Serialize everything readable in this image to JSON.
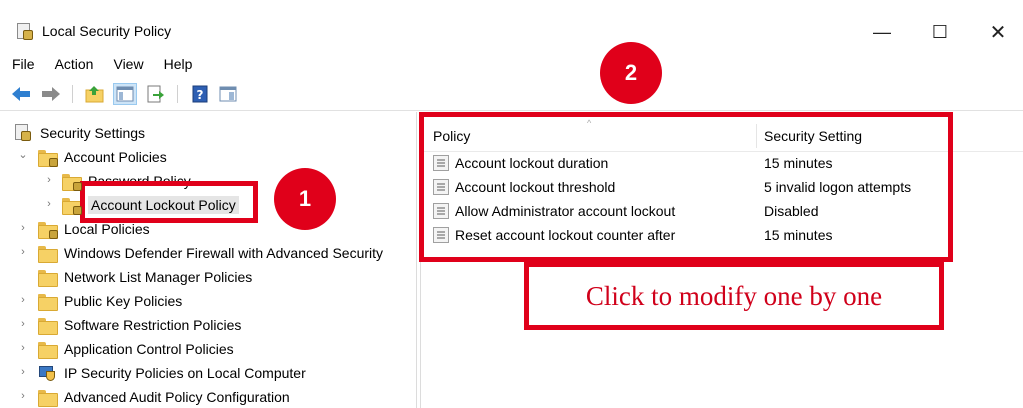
{
  "window": {
    "title": "Local Security Policy",
    "minimize_glyph": "—",
    "maximize_glyph": "☐",
    "close_glyph": "✕"
  },
  "menu": [
    "File",
    "Action",
    "View",
    "Help"
  ],
  "toolbar_icons": [
    "back-arrow-icon",
    "forward-arrow-icon",
    "up-folder-icon",
    "show-hide-tree-icon",
    "export-list-icon",
    "help-icon",
    "console-pane-icon"
  ],
  "tree": {
    "root": "Security Settings",
    "items": [
      {
        "label": "Account Policies",
        "chevron": "⌄"
      },
      {
        "label": "Password Policy",
        "chevron": "›"
      },
      {
        "label": "Account Lockout Policy",
        "chevron": "›"
      },
      {
        "label": "Local Policies",
        "chevron": "›"
      },
      {
        "label": "Windows Defender Firewall with Advanced Security",
        "chevron": "›"
      },
      {
        "label": "Network List Manager Policies",
        "chevron": ""
      },
      {
        "label": "Public Key Policies",
        "chevron": "›"
      },
      {
        "label": "Software Restriction Policies",
        "chevron": "›"
      },
      {
        "label": "Application Control Policies",
        "chevron": "›"
      },
      {
        "label": "IP Security Policies on Local Computer",
        "chevron": "›"
      },
      {
        "label": "Advanced Audit Policy Configuration",
        "chevron": "›"
      }
    ]
  },
  "list": {
    "columns": {
      "policy": "Policy",
      "setting": "Security Setting"
    },
    "sort_caret": "^",
    "rows": [
      {
        "policy": "Account lockout duration",
        "setting": "15 minutes"
      },
      {
        "policy": "Account lockout threshold",
        "setting": "5 invalid logon attempts"
      },
      {
        "policy": "Allow Administrator account lockout",
        "setting": "Disabled"
      },
      {
        "policy": "Reset account lockout counter after",
        "setting": "15 minutes"
      }
    ]
  },
  "annotations": {
    "badge1": "1",
    "badge2": "2",
    "callout": "Click to modify one by one",
    "color": "#e0001a"
  }
}
